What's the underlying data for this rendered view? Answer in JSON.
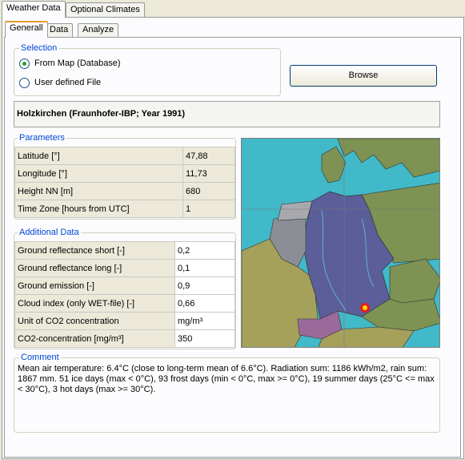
{
  "outer_tabs": [
    "Weather Data",
    "Optional Climates"
  ],
  "inner_tabs": [
    "Generall",
    "Data",
    "Analyze"
  ],
  "selection": {
    "label": "Selection",
    "option_map": "From Map (Database)",
    "option_file": "User defined File",
    "selected": "From Map (Database)"
  },
  "browse_label": "Browse",
  "location_title": "Holzkirchen (Fraunhofer-IBP; Year 1991)",
  "parameters": {
    "label": "Parameters",
    "rows": [
      {
        "name": "Latitude  [°]",
        "value": "47,88"
      },
      {
        "name": "Longitude  [°]",
        "value": "11,73"
      },
      {
        "name": "Height NN  [m]",
        "value": "680"
      },
      {
        "name": "Time Zone  [hours from UTC]",
        "value": "1"
      }
    ]
  },
  "additional": {
    "label": "Additional Data",
    "rows": [
      {
        "name": "Ground reflectance short  [-]",
        "value": "0,2"
      },
      {
        "name": "Ground reflectance long  [-]",
        "value": "0,1"
      },
      {
        "name": "Ground emission  [-]",
        "value": "0,9"
      },
      {
        "name": "Cloud index (only WET-file)  [-]",
        "value": "0,66"
      },
      {
        "name": "Unit of CO2 concentration",
        "value": "mg/m³"
      },
      {
        "name": "CO2-concentration  [mg/m³]",
        "value": "350"
      }
    ]
  },
  "comment": {
    "label": "Comment",
    "text": "Mean air temperature: 6.4°C (close to long-term mean of 6.6°C). Radiation sum: 1186 kWh/m2, rain sum: 1867 mm. 51 ice days (max < 0°C), 93 frost days (min < 0°C, max >= 0°C), 19 summer days (25°C <= max < 30°C), 3 hot days (max >= 30°C)."
  },
  "colors": {
    "sea": "#41b9c8",
    "germany": "#5b5e99",
    "neighbor_green": "#7d9253",
    "neighbor_olive": "#a5a15b",
    "benelux": "#8c8e95",
    "marker": "#e02020"
  }
}
